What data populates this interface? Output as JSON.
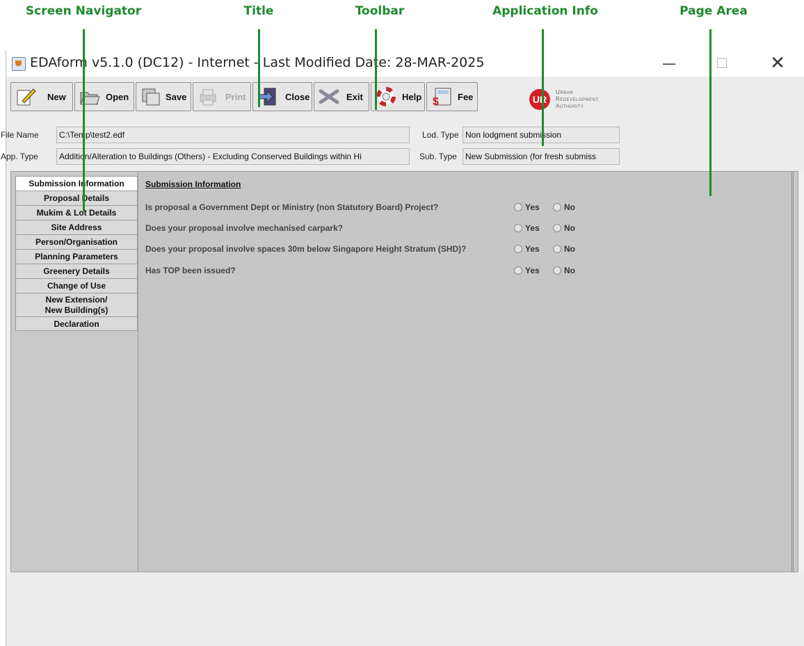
{
  "annotations": [
    {
      "label": "Screen Navigator"
    },
    {
      "label": "Title"
    },
    {
      "label": "Toolbar"
    },
    {
      "label": "Application Info"
    },
    {
      "label": "Page Area"
    }
  ],
  "window": {
    "title": "EDAform v5.1.0 (DC12) - Internet - Last Modified Date: 28-MAR-2025",
    "controls": {
      "minimize": "—",
      "maximize": "☐",
      "close": "✕"
    }
  },
  "toolbar": {
    "new_label": "New",
    "open_label": "Open",
    "save_label": "Save",
    "print_label": "Print",
    "close_label": "Close",
    "exit_label": "Exit",
    "help_label": "Help",
    "fee_label": "Fee"
  },
  "logo": {
    "mark": "UR",
    "line1": "Urban",
    "line2": "Redevelopment",
    "line3": "Authority",
    "color": "#d41f26"
  },
  "info": {
    "file_name_label": "File Name",
    "file_name_value": "C:\\Temp\\test2.edf",
    "app_type_label": "App. Type",
    "app_type_value": "Addition/Alteration to Buildings (Others) - Excluding Conserved Buildings within Hi",
    "lod_type_label": "Lod. Type",
    "lod_type_value": "Non lodgment submission",
    "sub_type_label": "Sub. Type",
    "sub_type_value": "New Submission (for fresh submiss"
  },
  "nav": {
    "items": [
      {
        "label": "Submission Information"
      },
      {
        "label": "Proposal Details"
      },
      {
        "label": "Mukim & Lot Details"
      },
      {
        "label": "Site Address"
      },
      {
        "label": "Person/Organisation"
      },
      {
        "label": "Planning Parameters"
      },
      {
        "label": "Greenery Details"
      },
      {
        "label": "Change of Use"
      },
      {
        "label": "New Extension/",
        "label2": "New Building(s)"
      },
      {
        "label": "Declaration"
      }
    ]
  },
  "page": {
    "title": "Submission Information",
    "yes_label": "Yes",
    "no_label": "No",
    "questions": [
      {
        "text": "Is proposal a Government Dept or Ministry (non Statutory Board) Project?"
      },
      {
        "text": "Does your proposal involve mechanised carpark?"
      },
      {
        "text": "Does your proposal involve spaces 30m below Singapore Height Stratum (SHD)?"
      },
      {
        "text": "Has TOP been issued?"
      }
    ]
  },
  "colors": {
    "annotation": "#1f8a2e",
    "accent": "#d41f26"
  }
}
